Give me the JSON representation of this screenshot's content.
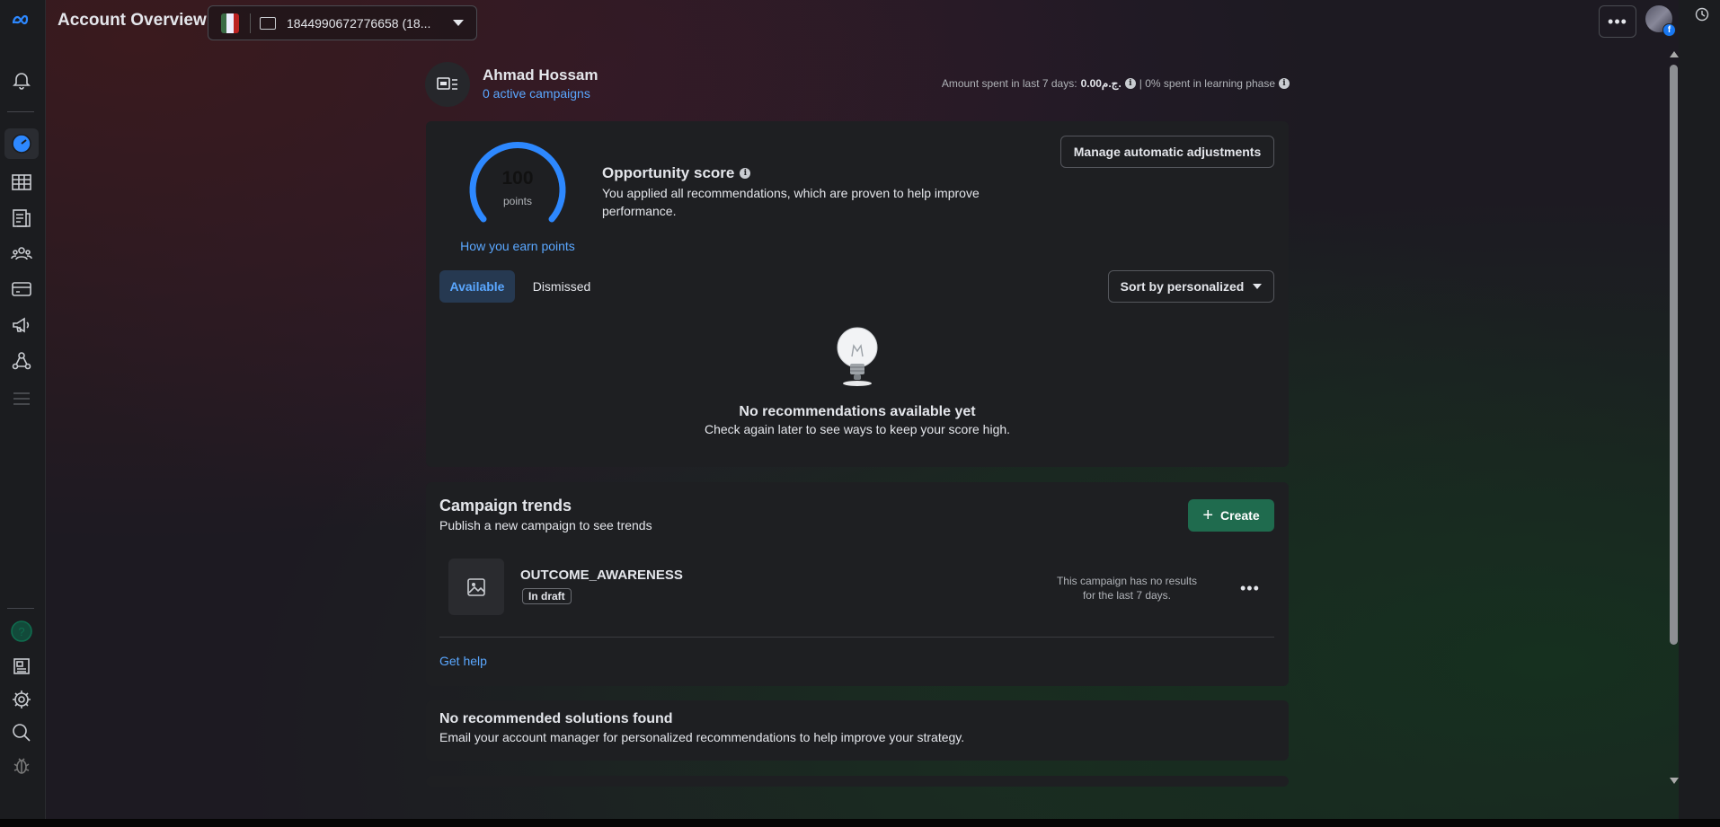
{
  "header": {
    "title": "Account Overview",
    "account_id_label": "1844990672776658 (18..."
  },
  "account": {
    "name": "Ahmad Hossam",
    "active_campaigns": "0 active campaigns",
    "spent_prefix": "Amount spent in last 7 days:",
    "spent_value": "0.00ج.م.",
    "learning_phase": "| 0% spent in learning phase"
  },
  "opportunity": {
    "score": "100",
    "score_unit": "points",
    "score_fraction": 1.0,
    "earn_link": "How you earn points",
    "title": "Opportunity score",
    "description": "You applied all recommendations, which are proven to help improve performance.",
    "manage_button": "Manage automatic adjustments",
    "tabs": [
      "Available",
      "Dismissed"
    ],
    "active_tab": "Available",
    "sort_label": "Sort by personalized",
    "empty_title": "No recommendations available yet",
    "empty_desc": "Check again later to see ways to keep your score high."
  },
  "trends": {
    "title": "Campaign trends",
    "subtitle": "Publish a new campaign to see trends",
    "create_button": "Create",
    "campaign": {
      "name": "OUTCOME_AWARENESS",
      "status": "In draft",
      "results_note": "This campaign has no results for the last 7 days."
    },
    "help_link": "Get help"
  },
  "solutions": {
    "title": "No recommended solutions found",
    "description": "Email your account manager for personalized recommendations to help improve your strategy."
  },
  "colors": {
    "accent_blue": "#2d88ff",
    "link_blue": "#5aa7ff",
    "create_green": "#1f6b4e",
    "card_bg": "#1e1f22"
  },
  "icons": {
    "nav": [
      "meta-logo-icon",
      "bell-icon",
      "dashboard-icon",
      "table-icon",
      "pages-icon",
      "audience-icon",
      "billing-icon",
      "megaphone-icon",
      "network-icon",
      "menu-icon",
      "help-icon",
      "news-icon",
      "gear-icon",
      "search-icon",
      "bug-icon"
    ]
  }
}
